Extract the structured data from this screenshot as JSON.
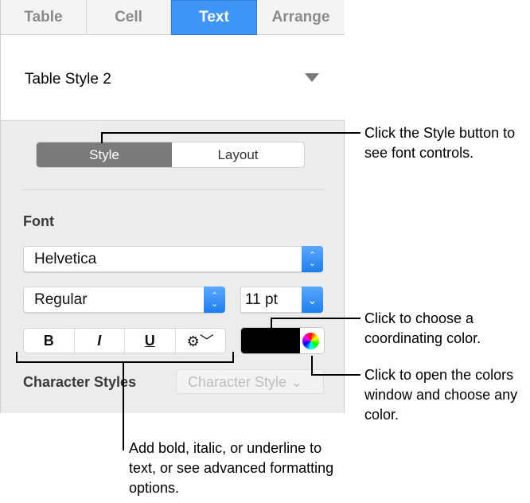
{
  "tabs": [
    {
      "label": "Table"
    },
    {
      "label": "Cell"
    },
    {
      "label": "Text"
    },
    {
      "label": "Arrange"
    }
  ],
  "table_style": {
    "value": "Table Style 2"
  },
  "segment": {
    "style": "Style",
    "layout": "Layout"
  },
  "font": {
    "section_label": "Font",
    "family": "Helvetica",
    "typeface": "Regular",
    "size": "11 pt"
  },
  "format_buttons": {
    "bold": "B",
    "italic": "I",
    "underline": "U"
  },
  "text_color": "#000000",
  "character_styles": {
    "label": "Character Styles",
    "placeholder": "Character Style"
  },
  "callouts": {
    "style": "Click the Style button to see font controls.",
    "color": "Click to choose a coordinating color.",
    "wheel": "Click to open the colors window and choose any color.",
    "format": "Add bold, italic, or underline to text, or see advanced formatting options."
  }
}
